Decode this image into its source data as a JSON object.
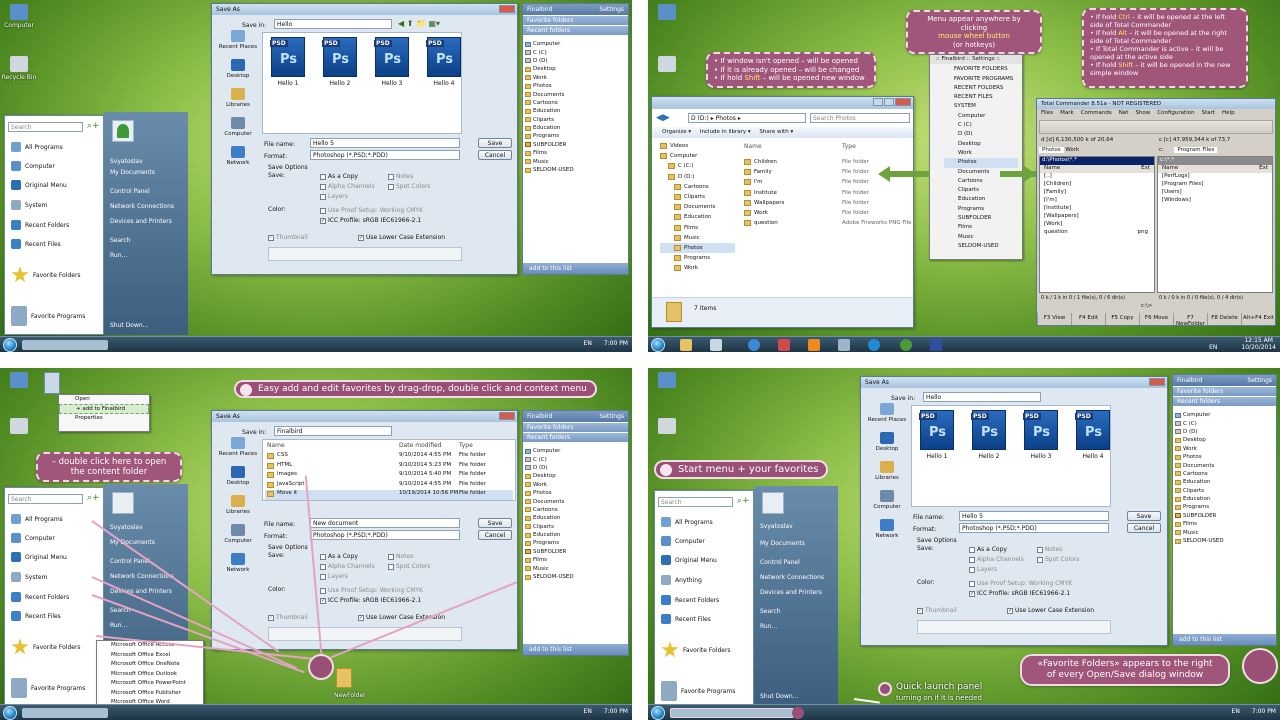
{
  "q1": {
    "desktop_icons": [
      "Computer",
      "Recycle Bin"
    ],
    "search_placeholder": "Search",
    "user": "Svyatoslav",
    "left_items": [
      "All Programs",
      "Computer",
      "Original Menu",
      "System",
      "Recent Folders",
      "Recent Files",
      "Favorite Folders",
      "Favorite Programs"
    ],
    "right_items": [
      "Svyatoslav",
      "My Documents",
      "Control Panel",
      "Network Connections",
      "Devices and Printers",
      "Search",
      "Run...",
      "Shut Down..."
    ],
    "taskbar": {
      "lang": "EN",
      "time": "7:00 PM"
    }
  },
  "saveas": {
    "title": "Save As",
    "save_in_label": "Save in:",
    "save_in_value": "Hello",
    "places": [
      "Recent Places",
      "Desktop",
      "Libraries",
      "Computer",
      "Network"
    ],
    "files": [
      "Hello 1",
      "Hello 2",
      "Hello 3",
      "Hello 4"
    ],
    "file_name_label": "File name:",
    "file_name_value": "Hello 5",
    "format_label": "Format:",
    "format_value": "Photoshop (*.PSD;*.PDD)",
    "save_btn": "Save",
    "cancel_btn": "Cancel",
    "save_options": "Save Options",
    "save_label": "Save:",
    "as_copy": "As a Copy",
    "notes": "Notes",
    "alpha": "Alpha Channels",
    "spot": "Spot Colors",
    "layers": "Layers",
    "color_label": "Color:",
    "proof": "Use Proof Setup:  Working CMYK",
    "icc": "ICC Profile:  sRGB IEC61966-2.1",
    "thumbnail": "Thumbnail",
    "lowercase": "Use Lower Case Extension"
  },
  "finalbird": {
    "title": "Finalbird",
    "settings": "Settings",
    "fav": "Favorite folders",
    "recent": "Recent folders",
    "list": [
      "Computer",
      "C (C)",
      "D (D)",
      "Desktop",
      "Work",
      "Photos",
      "Documents",
      "Cartoons",
      "Education",
      "Cliparts",
      "Education",
      "Programs",
      "SUBFOLDER",
      "Films",
      "Music",
      "SELDOM-USED"
    ],
    "add": "add to this list"
  },
  "q2": {
    "bubble_left": [
      "If window isn't opened – will be opened",
      "If it is already opened – will be changed",
      "If hold Shift – will be opened new window"
    ],
    "bubble_mid": [
      "Menu appear anywhere by clicking",
      "mouse wheel button",
      "(or hotkeys)"
    ],
    "bubble_right": [
      "If hold Ctrl – it will be opened at the left side of Total Commander",
      "If hold Alt – it will be opened at the right side of Total Commander",
      "If Total Commander is active – it will be opened at the active side",
      "If hold Shift – it will be opened in the new simple window"
    ],
    "menu_header": ":: Finalbird :: Settings ::",
    "menu": [
      "FAVORITE FOLDERS",
      "FAVORITE PROGRAMS",
      "RECENT FOLDERS",
      "RECENT FILES",
      "SYSTEM",
      "Computer",
      "C (C)",
      "D (D)",
      "Desktop",
      "Work",
      "Photos",
      "Documents",
      "Cartoons",
      "Cliparts",
      "Education",
      "Programs",
      "SUBFOLDER",
      "Films",
      "Music",
      "SELDOM-USED"
    ],
    "explorer": {
      "path": "D (D:) ▸ Photos ▸",
      "search": "Search Photos",
      "organize": "Organize ▾",
      "include": "Include in library ▾",
      "share": "Share with ▾",
      "tree": [
        "Videos",
        "Computer",
        "C (C:)",
        "D (D:)",
        "Cartoons",
        "Cliparts",
        "Documents",
        "Education",
        "Films",
        "Music",
        "Photos",
        "Programs",
        "Work"
      ],
      "col_name": "Name",
      "col_type": "Type",
      "files": [
        "Children",
        "Family",
        "I'm",
        "Institute",
        "Wallpapers",
        "Work",
        "question"
      ],
      "types": [
        "File folder",
        "File folder",
        "File folder",
        "File folder",
        "File folder",
        "File folder",
        "Adobe Fireworks PNG File"
      ],
      "status": "7 items"
    },
    "tc": {
      "title": "Total Commander 8.51a - NOT REGISTERED",
      "menu": [
        "Files",
        "Mark",
        "Commands",
        "Net",
        "Show",
        "Configuration",
        "Start",
        "Help"
      ],
      "left_drive": "d  [d]  6,130,500 k of 20,64",
      "right_drive": "c  [c]  47,959,344 k of 73,7",
      "tabs_left": [
        "Photos",
        "Work"
      ],
      "tabs_right": [
        "c:",
        "Program Files"
      ],
      "left_path": "d:\\Photos\\*.*",
      "right_path": "c:\\*.*",
      "col_name": "Name",
      "col_ext": "Ext",
      "left_files": [
        "[..]",
        "[Children]",
        "[Family]",
        "[I'm]",
        "[Institute]",
        "[Wallpapers]",
        "[Work]",
        "question"
      ],
      "left_ext": [
        "",
        "",
        "",
        "",
        "",
        "",
        "",
        "png"
      ],
      "right_files": [
        "[PerfLogs]",
        "[Program Files]",
        "[Users]",
        "[Windows]"
      ],
      "left_status": "0 k / 1 k in 0 / 1 file(s), 0 / 6 dir(s)",
      "right_status": "0 k / 0 k in 0 / 0 file(s), 0 / 4 dir(s)",
      "cmd": "c:\\>",
      "fkeys": [
        "F3 View",
        "F4 Edit",
        "F5 Copy",
        "F6 Move",
        "F7 NewFolder",
        "F8 Delete",
        "Alt+F4 Exit"
      ]
    },
    "taskbar": {
      "lang": "EN",
      "time": "12:15 AM",
      "date": "10/20/2014"
    }
  },
  "q3": {
    "banner": "Easy add and edit favorites by drag-drop, double click and context menu",
    "dbl_bubble": "– double click here to open the content folder",
    "ctx_menu": [
      "Open",
      "+ add to Finalbird",
      "Properties"
    ],
    "left_items": [
      "All Programs",
      "Computer",
      "Original Menu",
      "System",
      "Recent Folders",
      "Recent Files",
      "Favorite Folders",
      "Favorite Programs"
    ],
    "submenu": [
      "Microsoft Office Access",
      "Microsoft Office Excel",
      "Microsoft Office OneNote",
      "Microsoft Office Outlook",
      "Microsoft Office PowerPoint",
      "Microsoft Office Publisher",
      "Microsoft Office Word"
    ],
    "new_folder": "NewFolder",
    "dialog": {
      "save_in_value": "Finalbird",
      "col_name": "Name",
      "col_date": "Date modified",
      "col_type": "Type",
      "rows": [
        [
          "CSS",
          "9/10/2014 4:55 PM",
          "File folder"
        ],
        [
          "HTML",
          "9/10/2014 5:23 PM",
          "File folder"
        ],
        [
          "images",
          "9/10/2014 5:40 PM",
          "File folder"
        ],
        [
          "JavaScript",
          "9/10/2014 4:55 PM",
          "File folder"
        ],
        [
          "Move it",
          "10/19/2014 10:56 PM",
          "File folder"
        ]
      ],
      "file_name_value": "New document"
    },
    "taskbar": {
      "lang": "EN",
      "time": "7:00 PM"
    }
  },
  "q4": {
    "banner_start": "Start menu + your favorites",
    "left_items": [
      "All Programs",
      "Computer",
      "Original Menu",
      "Anything",
      "Recent Folders",
      "Recent Files",
      "Favorite Folders",
      "Favorite Programs"
    ],
    "banner_fav": [
      "«Favorite Folders» appears to the right",
      "of every Open/Save dialog window"
    ],
    "banner_ql": [
      "Quick launch panel",
      "turning on if it is needed"
    ],
    "taskbar": {
      "lang": "EN",
      "time": "7:00 PM"
    }
  },
  "colors": {
    "accent": "#9a4f76",
    "highlight": "#ffe86a",
    "wallpaper": "#8fc04a"
  }
}
